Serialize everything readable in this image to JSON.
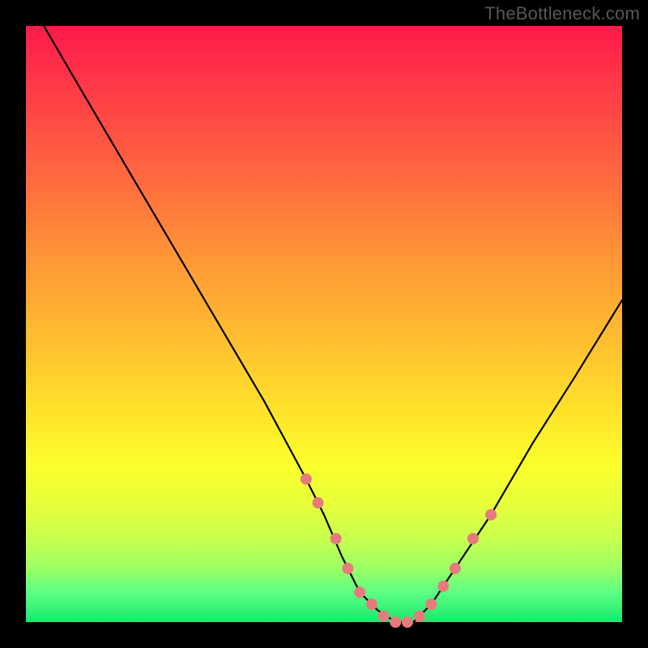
{
  "attribution": "TheBottleneck.com",
  "chart_data": {
    "type": "line",
    "title": "",
    "xlabel": "",
    "ylabel": "",
    "xlim": [
      0,
      100
    ],
    "ylim": [
      0,
      100
    ],
    "series": [
      {
        "name": "bottleneck-curve",
        "x": [
          3,
          10,
          20,
          30,
          40,
          47,
          50,
          53,
          56,
          59,
          62,
          65,
          68,
          72,
          78,
          85,
          92,
          100
        ],
        "y": [
          100,
          88,
          71,
          54,
          37,
          24,
          18,
          11,
          5,
          2,
          0,
          0,
          3,
          9,
          18,
          30,
          41,
          54
        ]
      }
    ],
    "markers": {
      "name": "threshold-dots",
      "color": "#e77b7b",
      "radius_px": 7,
      "x": [
        47,
        49,
        52,
        54,
        56,
        58,
        60,
        62,
        64,
        66,
        68,
        70,
        72,
        75,
        78
      ],
      "y": [
        24,
        20,
        14,
        9,
        5,
        3,
        1,
        0,
        0,
        1,
        3,
        6,
        9,
        14,
        18
      ]
    },
    "gradient_stops": [
      {
        "pos": 0,
        "color": "#ff1a4a"
      },
      {
        "pos": 40,
        "color": "#ff9a36"
      },
      {
        "pos": 66,
        "color": "#ffe72a"
      },
      {
        "pos": 100,
        "color": "#18e86e"
      }
    ]
  }
}
